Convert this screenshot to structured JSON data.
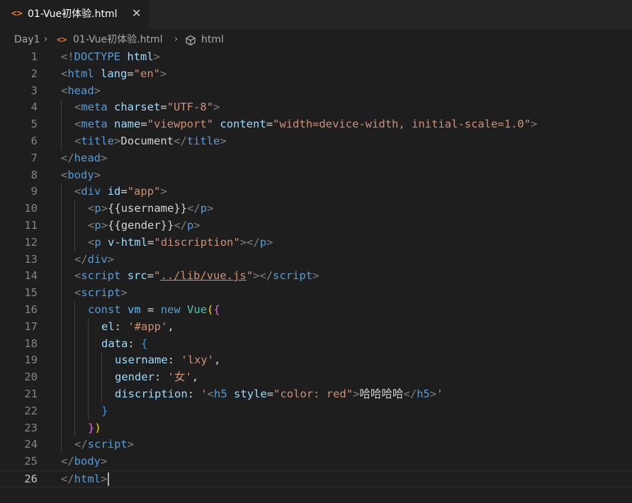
{
  "tab": {
    "icon": "html-file-icon",
    "label": "01-Vue初体验.html",
    "close_symbol": "✕"
  },
  "breadcrumb": {
    "folder": "Day1",
    "file": "01-Vue初体验.html",
    "symbol": "html"
  },
  "colors": {
    "tag_bracket": "#808080",
    "tag_name": "#569cd6",
    "attribute": "#9cdcfe",
    "string": "#ce9178",
    "text": "#d4d4d4",
    "keyword": "#569cd6",
    "variable": "#4fc1ff",
    "class_name": "#4ec9b0",
    "bracket_gold": "#ffd700",
    "bracket_purple": "#da70d6",
    "bracket_blue": "#179fff",
    "file_icon": "#e37933"
  },
  "editor": {
    "current_line": 26,
    "lines": [
      {
        "n": "1",
        "indent": 0,
        "tokens": [
          [
            "tg",
            "<!"
          ],
          [
            "tn",
            "DOCTYPE"
          ],
          [
            "tx",
            " "
          ],
          [
            "at",
            "html"
          ],
          [
            "tg",
            ">"
          ]
        ]
      },
      {
        "n": "2",
        "indent": 0,
        "tokens": [
          [
            "tg",
            "<"
          ],
          [
            "tn",
            "html"
          ],
          [
            "tx",
            " "
          ],
          [
            "at",
            "lang"
          ],
          [
            "tx",
            "="
          ],
          [
            "st",
            "\"en\""
          ],
          [
            "tg",
            ">"
          ]
        ]
      },
      {
        "n": "3",
        "indent": 0,
        "tokens": [
          [
            "tg",
            "<"
          ],
          [
            "tn",
            "head"
          ],
          [
            "tg",
            ">"
          ]
        ]
      },
      {
        "n": "4",
        "indent": 1,
        "tokens": [
          [
            "tg",
            "<"
          ],
          [
            "tn",
            "meta"
          ],
          [
            "tx",
            " "
          ],
          [
            "at",
            "charset"
          ],
          [
            "tx",
            "="
          ],
          [
            "st",
            "\"UTF-8\""
          ],
          [
            "tg",
            ">"
          ]
        ]
      },
      {
        "n": "5",
        "indent": 1,
        "tokens": [
          [
            "tg",
            "<"
          ],
          [
            "tn",
            "meta"
          ],
          [
            "tx",
            " "
          ],
          [
            "at",
            "name"
          ],
          [
            "tx",
            "="
          ],
          [
            "st",
            "\"viewport\""
          ],
          [
            "tx",
            " "
          ],
          [
            "at",
            "content"
          ],
          [
            "tx",
            "="
          ],
          [
            "st",
            "\"width=device-width, initial-scale=1.0\""
          ],
          [
            "tg",
            ">"
          ]
        ]
      },
      {
        "n": "6",
        "indent": 1,
        "tokens": [
          [
            "tg",
            "<"
          ],
          [
            "tn",
            "title"
          ],
          [
            "tg",
            ">"
          ],
          [
            "tx",
            "Document"
          ],
          [
            "tg",
            "</"
          ],
          [
            "tn",
            "title"
          ],
          [
            "tg",
            ">"
          ]
        ]
      },
      {
        "n": "7",
        "indent": 0,
        "tokens": [
          [
            "tg",
            "</"
          ],
          [
            "tn",
            "head"
          ],
          [
            "tg",
            ">"
          ]
        ]
      },
      {
        "n": "8",
        "indent": 0,
        "tokens": [
          [
            "tg",
            "<"
          ],
          [
            "tn",
            "body"
          ],
          [
            "tg",
            ">"
          ]
        ]
      },
      {
        "n": "9",
        "indent": 1,
        "tokens": [
          [
            "tg",
            "<"
          ],
          [
            "tn",
            "div"
          ],
          [
            "tx",
            " "
          ],
          [
            "at",
            "id"
          ],
          [
            "tx",
            "="
          ],
          [
            "st",
            "\"app\""
          ],
          [
            "tg",
            ">"
          ]
        ]
      },
      {
        "n": "10",
        "indent": 2,
        "tokens": [
          [
            "tg",
            "<"
          ],
          [
            "tn",
            "p"
          ],
          [
            "tg",
            ">"
          ],
          [
            "tx",
            "{{username}}"
          ],
          [
            "tg",
            "</"
          ],
          [
            "tn",
            "p"
          ],
          [
            "tg",
            ">"
          ]
        ]
      },
      {
        "n": "11",
        "indent": 2,
        "tokens": [
          [
            "tg",
            "<"
          ],
          [
            "tn",
            "p"
          ],
          [
            "tg",
            ">"
          ],
          [
            "tx",
            "{{gender}}"
          ],
          [
            "tg",
            "</"
          ],
          [
            "tn",
            "p"
          ],
          [
            "tg",
            ">"
          ]
        ]
      },
      {
        "n": "12",
        "indent": 2,
        "tokens": [
          [
            "tg",
            "<"
          ],
          [
            "tn",
            "p"
          ],
          [
            "tx",
            " "
          ],
          [
            "at",
            "v-html"
          ],
          [
            "tx",
            "="
          ],
          [
            "st",
            "\"discription\""
          ],
          [
            "tg",
            "></"
          ],
          [
            "tn",
            "p"
          ],
          [
            "tg",
            ">"
          ]
        ]
      },
      {
        "n": "13",
        "indent": 1,
        "tokens": [
          [
            "tg",
            "</"
          ],
          [
            "tn",
            "div"
          ],
          [
            "tg",
            ">"
          ]
        ]
      },
      {
        "n": "14",
        "indent": 1,
        "tokens": [
          [
            "tg",
            "<"
          ],
          [
            "tn",
            "script"
          ],
          [
            "tx",
            " "
          ],
          [
            "at",
            "src"
          ],
          [
            "tx",
            "="
          ],
          [
            "st",
            "\""
          ],
          [
            "st ul",
            "../lib/vue.js"
          ],
          [
            "st",
            "\""
          ],
          [
            "tg",
            "></"
          ],
          [
            "tn",
            "script"
          ],
          [
            "tg",
            ">"
          ]
        ]
      },
      {
        "n": "15",
        "indent": 1,
        "tokens": [
          [
            "tg",
            "<"
          ],
          [
            "tn",
            "script"
          ],
          [
            "tg",
            ">"
          ]
        ]
      },
      {
        "n": "16",
        "indent": 2,
        "tokens": [
          [
            "kw",
            "const"
          ],
          [
            "tx",
            " "
          ],
          [
            "vr",
            "vm"
          ],
          [
            "tx",
            " = "
          ],
          [
            "kw",
            "new"
          ],
          [
            "tx",
            " "
          ],
          [
            "fn",
            "Vue"
          ],
          [
            "b1",
            "("
          ],
          [
            "b2",
            "{"
          ]
        ]
      },
      {
        "n": "17",
        "indent": 3,
        "tokens": [
          [
            "pr",
            "el"
          ],
          [
            "tx",
            ": "
          ],
          [
            "st",
            "'#app'"
          ],
          [
            "tx",
            ","
          ]
        ]
      },
      {
        "n": "18",
        "indent": 3,
        "tokens": [
          [
            "pr",
            "data"
          ],
          [
            "tx",
            ": "
          ],
          [
            "b3",
            "{"
          ]
        ]
      },
      {
        "n": "19",
        "indent": 4,
        "tokens": [
          [
            "pr",
            "username"
          ],
          [
            "tx",
            ": "
          ],
          [
            "st",
            "'lxy'"
          ],
          [
            "tx",
            ","
          ]
        ]
      },
      {
        "n": "20",
        "indent": 4,
        "tokens": [
          [
            "pr",
            "gender"
          ],
          [
            "tx",
            ": "
          ],
          [
            "st",
            "'女'"
          ],
          [
            "tx",
            ","
          ]
        ]
      },
      {
        "n": "21",
        "indent": 4,
        "tokens": [
          [
            "pr",
            "discription"
          ],
          [
            "tx",
            ": "
          ],
          [
            "st",
            "'"
          ],
          [
            "tg",
            "<"
          ],
          [
            "tn",
            "h5"
          ],
          [
            "tx",
            " "
          ],
          [
            "at",
            "style"
          ],
          [
            "tx",
            "="
          ],
          [
            "st",
            "\"color: red\""
          ],
          [
            "tg",
            ">"
          ],
          [
            "tx",
            "哈哈哈哈"
          ],
          [
            "tg",
            "</"
          ],
          [
            "tn",
            "h5"
          ],
          [
            "tg",
            ">"
          ],
          [
            "st",
            "'"
          ]
        ]
      },
      {
        "n": "22",
        "indent": 3,
        "tokens": [
          [
            "b3",
            "}"
          ]
        ]
      },
      {
        "n": "23",
        "indent": 2,
        "tokens": [
          [
            "b2",
            "}"
          ],
          [
            "b1",
            ")"
          ]
        ]
      },
      {
        "n": "24",
        "indent": 1,
        "tokens": [
          [
            "tg",
            "</"
          ],
          [
            "tn",
            "script"
          ],
          [
            "tg",
            ">"
          ]
        ]
      },
      {
        "n": "25",
        "indent": 0,
        "tokens": [
          [
            "tg",
            "</"
          ],
          [
            "tn",
            "body"
          ],
          [
            "tg",
            ">"
          ]
        ]
      },
      {
        "n": "26",
        "indent": 0,
        "tokens": [
          [
            "tg",
            "</"
          ],
          [
            "tn",
            "html"
          ],
          [
            "tg",
            ">"
          ]
        ]
      }
    ]
  }
}
